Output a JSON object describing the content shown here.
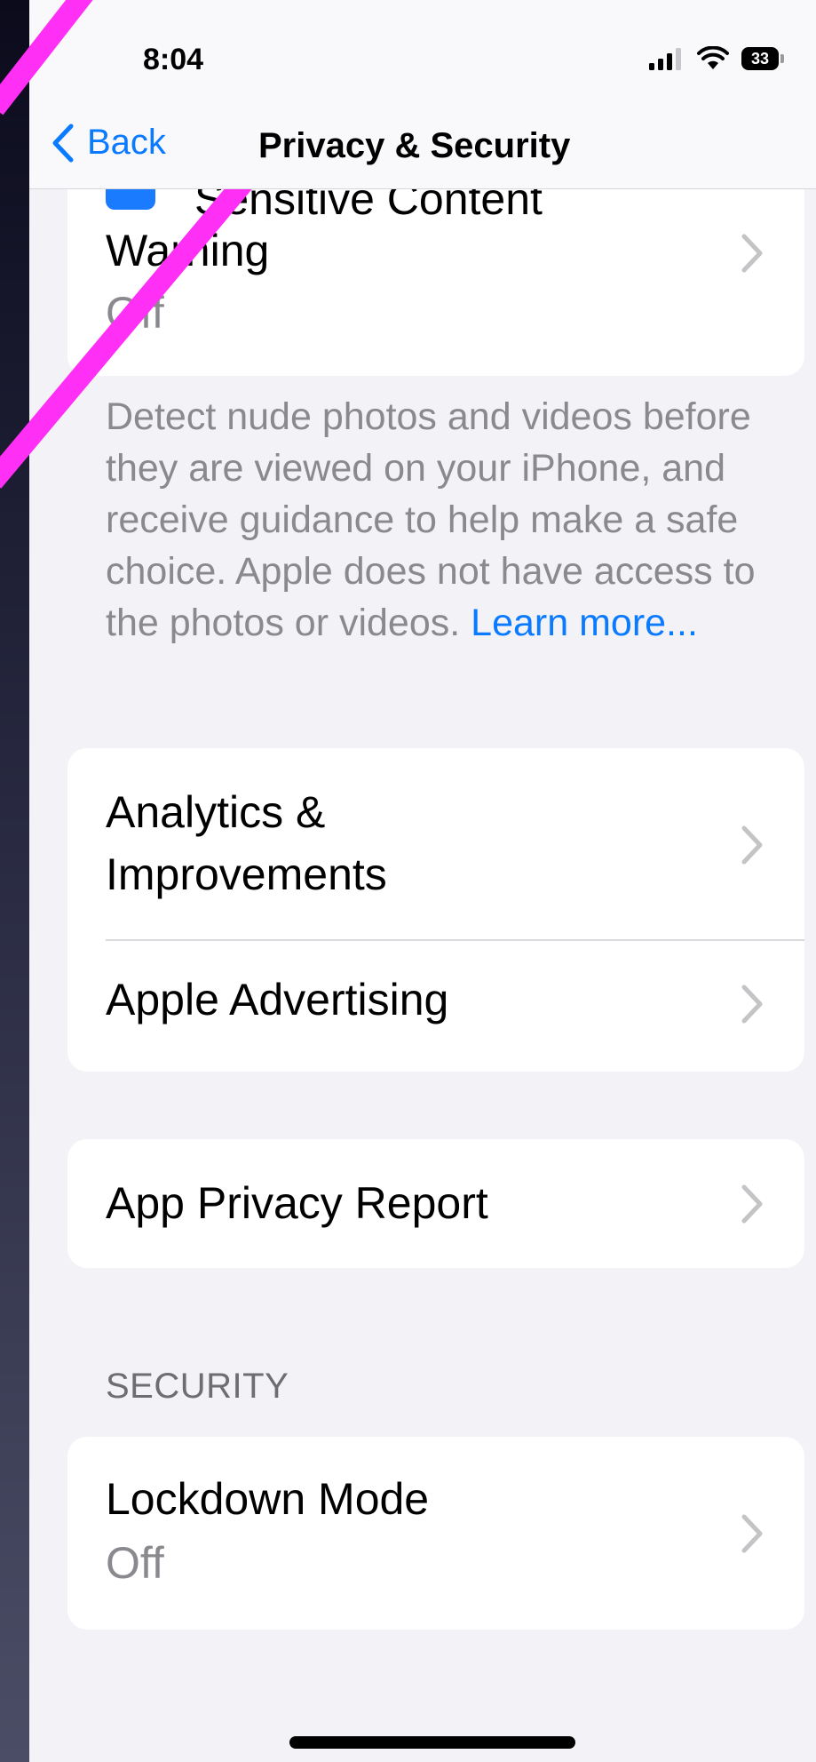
{
  "status_bar": {
    "time": "8:04",
    "battery": "33"
  },
  "nav": {
    "back_label": "Back",
    "title": "Privacy & Security"
  },
  "sensitive_content": {
    "title_line1": "Sensitive Content",
    "title_line2": "Warning",
    "value": "Off",
    "footnote": "Detect nude photos and videos before they are viewed on your iPhone, and receive guidance to help make a safe choice. Apple does not have access to the photos or videos.",
    "learn_more": "Learn more..."
  },
  "group1": {
    "analytics_line1": "Analytics &",
    "analytics_line2": "Improvements",
    "apple_advertising": "Apple Advertising"
  },
  "group2": {
    "app_privacy_report": "App Privacy Report"
  },
  "security": {
    "header": "SECURITY",
    "lockdown_title": "Lockdown Mode",
    "lockdown_value": "Off"
  },
  "colors": {
    "accent": "#0a7aff",
    "overlay": "#ff2ff5"
  }
}
